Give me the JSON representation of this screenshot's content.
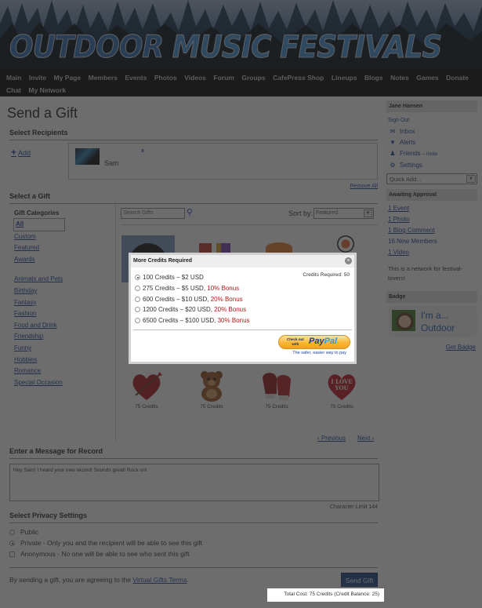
{
  "site": {
    "logo_word1": "OUTDOOR",
    "logo_word2": "MUSIC FESTIVALS"
  },
  "nav": {
    "items": [
      "Main",
      "Invite",
      "My Page",
      "Members",
      "Events",
      "Photos",
      "Videos",
      "Forum",
      "Groups",
      "CafePress Shop",
      "Lineups",
      "Blogs",
      "Notes",
      "Games",
      "Donate",
      "Chat",
      "My Network"
    ]
  },
  "page": {
    "title": "Send a Gift",
    "recipients": {
      "heading": "Select Recipients",
      "add_label": "Add",
      "add_icon": "plus-icon",
      "selected": [
        {
          "name": "Sam",
          "remove": "x"
        }
      ],
      "remove_all": "Remove All"
    },
    "gift": {
      "heading": "Select a Gift",
      "categories_heading": "Gift Categories",
      "categories_primary": [
        "All",
        "Custom",
        "Featured",
        "Awards"
      ],
      "categories_secondary": [
        "Animals and Pets",
        "Birthday",
        "Fantasy",
        "Fashion",
        "Food and Drink",
        "Friendship",
        "Funny",
        "Hobbies",
        "Romance",
        "Special Occasion"
      ],
      "selected_category": "All",
      "search_placeholder": "Search Gifts",
      "search_icon": "magnifier-icon",
      "sort_label": "Sort by:",
      "sort_value": "Featured",
      "gifts_row1": [
        {
          "name": "record",
          "credits": ""
        },
        {
          "name": "sushi-and-cocktail",
          "credits": ""
        },
        {
          "name": "pizza-slice",
          "credits": ""
        },
        {
          "name": "sushi-roll",
          "credits": ""
        }
      ],
      "gifts_row3": [
        {
          "name": "heart-with-arrow",
          "credits": "75 Credits"
        },
        {
          "name": "teddy-bear",
          "credits": "75 Credits"
        },
        {
          "name": "boxing-gloves",
          "credits": "75 Credits"
        },
        {
          "name": "i-love-you-balloon",
          "credits": "75 Credits",
          "balloon_text": "I LOVE YOU"
        }
      ],
      "previous": "‹ Previous",
      "next": "Next ›"
    },
    "message": {
      "heading": "Enter a Message for Record",
      "value": "Hey Sam! I heard your new record! Sounds great! Rock on!",
      "char_limit": "Character Limit 144"
    },
    "privacy": {
      "heading": "Select Privacy Settings",
      "options": [
        {
          "label": "Public",
          "type": "radio",
          "checked": false
        },
        {
          "label": "Private - Only you and the recipient will be able to see this gift",
          "type": "radio",
          "checked": true
        },
        {
          "label": "Anonymous - No one will be able to see who sent this gift",
          "type": "checkbox",
          "checked": false
        }
      ]
    },
    "terms_prefix": "By sending a gift, you are agreeing to the ",
    "terms_link": "Virtual Gifts Terms",
    "terms_suffix": ".",
    "send_button": "Send Gift",
    "total_cost": "Total Cost: 75 Credits (Credit Balance: 25)"
  },
  "sidebar": {
    "user_name": "Jane Hansen",
    "sign_out": "Sign Out",
    "links": [
      {
        "label": "Inbox",
        "icon": "envelope-icon"
      },
      {
        "label": "Alerts",
        "icon": "flag-icon"
      },
      {
        "label": "Friends",
        "icon": "person-icon",
        "extra": "– Invite"
      },
      {
        "label": "Settings",
        "icon": "gear-icon"
      }
    ],
    "quick_add": "Quick Add...",
    "awaiting_heading": "Awaiting Approval",
    "awaiting": [
      "1 Event",
      "1 Photo",
      "1 Blog Comment",
      "16 New Members",
      "1 Video"
    ],
    "about": "This is a network for festival-lovers!",
    "badge_heading": "Badge",
    "badge_text_line1": "I'm a...",
    "badge_text_line2": "Outdoor",
    "get_badge": "Get Badge"
  },
  "modal": {
    "title": "More Credits Required",
    "close_icon": "close-icon",
    "credits_required": "Credits Required: 50",
    "options": [
      {
        "label": "100 Credits – $2 USD",
        "bonus": "",
        "selected": true
      },
      {
        "label": "275 Credits – $5 USD, ",
        "bonus": "10% Bonus",
        "selected": false
      },
      {
        "label": "600 Credits – $10 USD, ",
        "bonus": "20% Bonus",
        "selected": false
      },
      {
        "label": "1200 Credits – $20 USD, ",
        "bonus": "20% Bonus",
        "selected": false
      },
      {
        "label": "6500 Credits – $100 USD, ",
        "bonus": "30% Bonus",
        "selected": false
      }
    ],
    "paypal_checkout_line1": "Check out",
    "paypal_checkout_line2": "with",
    "paypal_brand_a": "Pay",
    "paypal_brand_b": "Pal",
    "paypal_tagline": "The safer, easier way to pay"
  },
  "colors": {
    "link": "#1a3d9a",
    "bonus": "#b11a1a",
    "send_button": "#1c4a8e",
    "overlay": "rgba(40,40,40,0.68)"
  }
}
